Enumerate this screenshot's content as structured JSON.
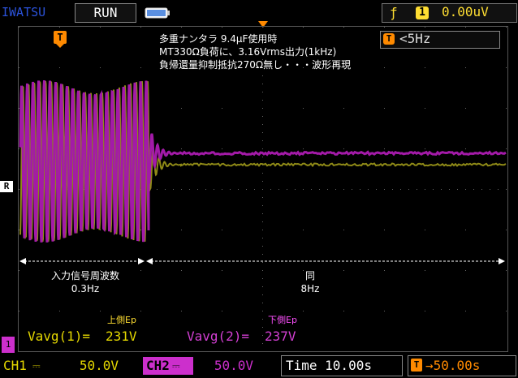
{
  "header": {
    "brand": "IWATSU",
    "run_status": "RUN",
    "trigger_edge_icon": "rising-edge",
    "trigger_channel": "1",
    "trigger_level": "0.00uV"
  },
  "freq_counter": {
    "icon": "T",
    "value": "<5Hz"
  },
  "trigger_marker": "T",
  "ref_marker": "R",
  "ch1_ground_marker": "1",
  "annotations": {
    "line1": "多重ナンタラ 9.4μF使用時",
    "line2": "MT330Ω負荷に、3.16Vrms出力(1kHz)",
    "line3": "負帰還量抑制抵抗270Ω無し・・・波形再現",
    "left_span": "入力信号周波数",
    "left_freq": "0.3Hz",
    "right_span": "同",
    "right_freq": "8Hz",
    "upper_ep": "上側Ep",
    "lower_ep": "下側Ep",
    "vavg1_label": "Vavg(1)=",
    "vavg1_value": "231V",
    "vavg2_label": "Vavg(2)=",
    "vavg2_value": "237V"
  },
  "footer": {
    "ch1_label": "CH1",
    "ch1_coupling": "⎓",
    "ch1_scale": "50.0V",
    "ch2_label": "CH2",
    "ch2_coupling": "⎓",
    "ch2_scale": "50.0V",
    "timebase": "Time 10.00s",
    "hpos_icon": "T",
    "hpos_value": "→50.00s"
  },
  "colors": {
    "ch1": "#8f8a17",
    "ch2": "#a31aa8",
    "accent_orange": "#ff8a00",
    "yellow": "#ffde32",
    "magenta": "#cc2fcc"
  }
}
